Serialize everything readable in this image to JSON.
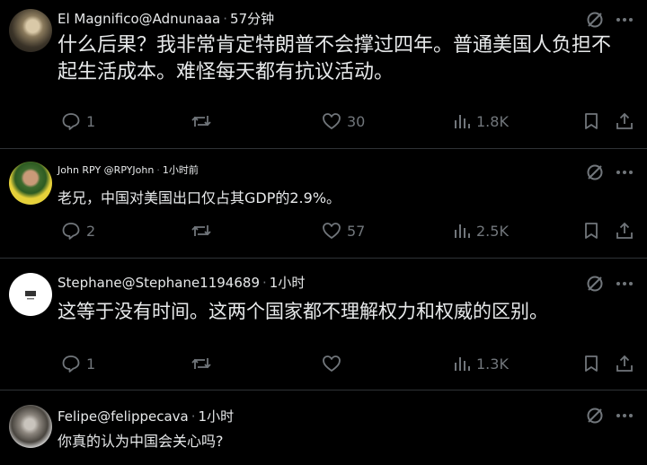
{
  "posts": [
    {
      "name": "El Magnifico",
      "handle": "@Adnunaaa",
      "sep": "·",
      "time": "57分钟",
      "text": "什么后果？我非常肯定特朗普不会撑过四年。普通美国人负担不起生活成本。难怪每天都有抗议活动。",
      "replies": "1",
      "reposts": "",
      "likes": "30",
      "views": "1.8K"
    },
    {
      "name": "John RPY",
      "handle": "@RPYJohn",
      "sep": "·",
      "time": "1小时前",
      "text": "老兄，中国对美国出口仅占其GDP的2.9%。",
      "replies": "2",
      "reposts": "",
      "likes": "57",
      "views": "2.5K"
    },
    {
      "name": "Stephane",
      "handle": "@Stephane1194689",
      "sep": "·",
      "time": "1小时",
      "text": "这等于没有时间。这两个国家都不理解权力和权威的区别。",
      "replies": "1",
      "reposts": "",
      "likes": "",
      "views": "1.3K"
    },
    {
      "name": "Felipe",
      "handle": "@felippecava",
      "sep": "·",
      "time": "1小时",
      "text": "你真的认为中国会关心吗?",
      "replies": "",
      "reposts": "",
      "likes": "",
      "views": ""
    }
  ],
  "colors": {
    "background": "#000000",
    "text": "#e7e9ea",
    "muted": "#71767b",
    "divider": "#2f3336"
  },
  "icons": [
    "grok-icon",
    "more-icon",
    "reply-icon",
    "repost-icon",
    "like-icon",
    "views-icon",
    "bookmark-icon",
    "share-icon"
  ]
}
